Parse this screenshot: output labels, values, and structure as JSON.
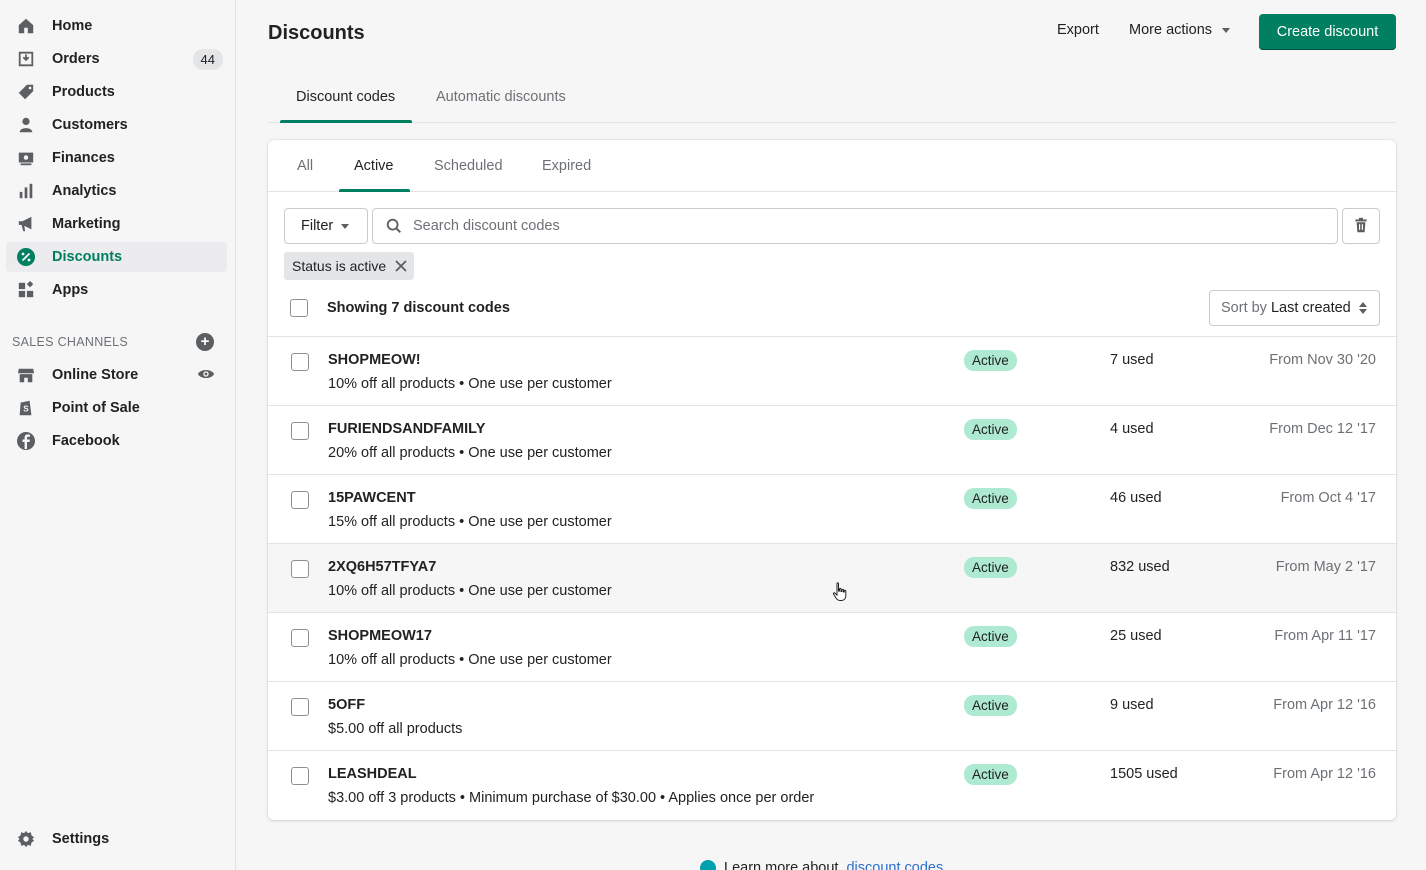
{
  "sidebar": {
    "items": [
      {
        "label": "Home",
        "icon": "home-icon"
      },
      {
        "label": "Orders",
        "icon": "orders-icon",
        "badge": "44"
      },
      {
        "label": "Products",
        "icon": "tag-icon"
      },
      {
        "label": "Customers",
        "icon": "person-icon"
      },
      {
        "label": "Finances",
        "icon": "finances-icon"
      },
      {
        "label": "Analytics",
        "icon": "bar-chart-icon"
      },
      {
        "label": "Marketing",
        "icon": "megaphone-icon"
      },
      {
        "label": "Discounts",
        "icon": "discount-icon",
        "active": true
      },
      {
        "label": "Apps",
        "icon": "apps-icon"
      }
    ],
    "sales_channels_label": "SALES CHANNELS",
    "channels": [
      {
        "label": "Online Store",
        "icon": "store-icon"
      },
      {
        "label": "Point of Sale",
        "icon": "pos-icon"
      },
      {
        "label": "Facebook",
        "icon": "facebook-icon"
      }
    ],
    "settings_label": "Settings"
  },
  "header": {
    "title": "Discounts",
    "export_label": "Export",
    "more_actions_label": "More actions",
    "create_label": "Create discount"
  },
  "tabs": {
    "discount_codes": "Discount codes",
    "automatic": "Automatic discounts"
  },
  "sub_tabs": {
    "all": "All",
    "active": "Active",
    "scheduled": "Scheduled",
    "expired": "Expired"
  },
  "filter": {
    "button_label": "Filter",
    "search_placeholder": "Search discount codes",
    "chip_label": "Status is active"
  },
  "list": {
    "showing": "Showing 7 discount codes",
    "sort_prefix": "Sort by",
    "sort_value": "Last created",
    "status_label": "Active",
    "rows": [
      {
        "code": "SHOPMEOW!",
        "desc": "10% off all products • One use per customer",
        "used": "7 used",
        "from": "From Nov 30 '20"
      },
      {
        "code": "FURIENDSANDFAMILY",
        "desc": "20% off all products • One use per customer",
        "used": "4 used",
        "from": "From Dec 12 '17"
      },
      {
        "code": "15PAWCENT",
        "desc": "15% off all products • One use per customer",
        "used": "46 used",
        "from": "From Oct 4 '17"
      },
      {
        "code": "2XQ6H57TFYA7",
        "desc": "10% off all products • One use per customer",
        "used": "832 used",
        "from": "From May 2 '17"
      },
      {
        "code": "SHOPMEOW17",
        "desc": "10% off all products • One use per customer",
        "used": "25 used",
        "from": "From Apr 11 '17"
      },
      {
        "code": "5OFF",
        "desc": "$5.00 off all products",
        "used": "9 used",
        "from": "From Apr 12 '16"
      },
      {
        "code": "LEASHDEAL",
        "desc": "$3.00 off 3 products • Minimum purchase of $30.00 • Applies once per order",
        "used": "1505 used",
        "from": "From Apr 12 '16"
      }
    ]
  },
  "footer": {
    "learn_prefix": "Learn more about",
    "learn_link": "discount codes"
  },
  "colors": {
    "accent": "#008060",
    "active_badge": "#aee9d1",
    "link": "#2c6ecb"
  }
}
